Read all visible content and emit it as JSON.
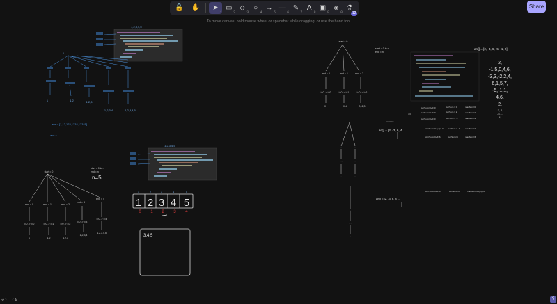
{
  "toolbar": {
    "tools": [
      {
        "name": "lock-icon",
        "glyph": "🔓",
        "key": ""
      },
      {
        "name": "hand-icon",
        "glyph": "✋",
        "key": ""
      },
      {
        "name": "selection-icon",
        "glyph": "➤",
        "key": "1"
      },
      {
        "name": "rectangle-icon",
        "glyph": "▭",
        "key": "2"
      },
      {
        "name": "diamond-icon",
        "glyph": "◇",
        "key": "3"
      },
      {
        "name": "ellipse-icon",
        "glyph": "○",
        "key": "4"
      },
      {
        "name": "arrow-icon",
        "glyph": "→",
        "key": "5"
      },
      {
        "name": "line-icon",
        "glyph": "—",
        "key": "6"
      },
      {
        "name": "pencil-icon",
        "glyph": "✎",
        "key": "7"
      },
      {
        "name": "text-icon",
        "glyph": "A",
        "key": "8"
      },
      {
        "name": "image-icon",
        "glyph": "▣",
        "key": "9"
      },
      {
        "name": "eraser-icon",
        "glyph": "◈",
        "key": "0"
      },
      {
        "name": "library-icon",
        "glyph": "⚗",
        "key": ""
      }
    ],
    "library_badge": "12"
  },
  "share_label": "Share",
  "hint": "To move canvas, hold mouse wheel or spacebar while dragging, or use the hand tool",
  "undo_glyph": "↶",
  "redo_glyph": "↷",
  "help_glyph": "?",
  "canvas": {
    "tree1": {
      "root": "0",
      "labels": [
        "1",
        "1,2",
        "1,2,3",
        "1,2,3,4",
        "1,2,3,4,5"
      ],
      "ans": "ans = [1,12,123,1234,12345]",
      "ans2": "ans = ,",
      "code_title": "1,2,3,4,5"
    },
    "tree2": {
      "root": "start = 0",
      "note": "start = 0 to n\nend = n",
      "n_label": "n=5",
      "labels": [
        "1",
        "1,2",
        "1,2,3",
        "1,2,3,4",
        "1,2,3,4,5"
      ],
      "code_title": "1,2,3,4,5"
    },
    "boxes": {
      "digits": [
        "1",
        "2",
        "3",
        "4",
        "5"
      ],
      "top_index": [
        "1",
        "2",
        "3",
        "4",
        "5"
      ],
      "bottom_index": [
        "0",
        "1",
        "2",
        "3",
        "4"
      ]
    },
    "note_box": "3,4,5",
    "tree3": {
      "root": "start = 0",
      "labels": [
        "end = 0",
        "end = 1",
        "end = 2"
      ],
      "sub": [
        "0",
        "0,-2",
        "0,-2,3"
      ]
    },
    "right_note": "start = 0 to n\nend = n",
    "arr_top": "arr[] = [2, -3, 6, -5, -1, 2]",
    "arr_mid": "arr[] = [2, -3, 6, 4 ...",
    "arr_low": "arr[] = [2, -3, 6, 4 ...",
    "sums": [
      "2,",
      "-1,5,0,4,6,",
      "-3,3,-2,2,4,",
      "6,1,5,7,",
      "-5,-1,1,",
      "4,6,",
      "2,"
    ],
    "sums2": [
      "-3,-1,",
      "-5,1,",
      "4,"
    ]
  }
}
